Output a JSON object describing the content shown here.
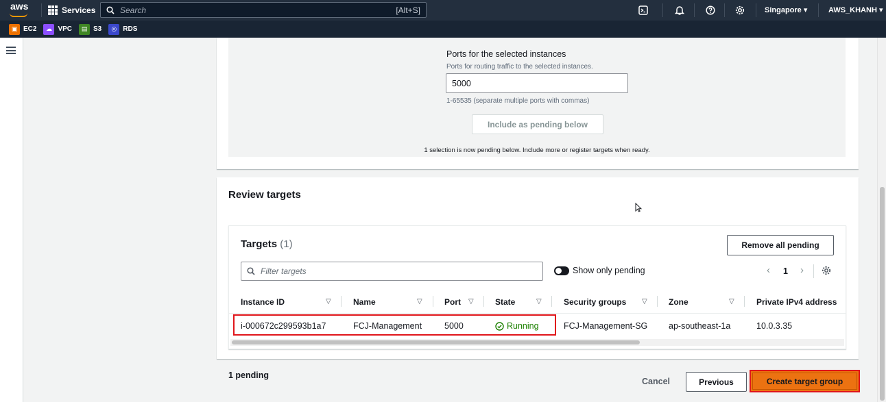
{
  "topnav": {
    "logo": "aws",
    "services_label": "Services",
    "search_placeholder": "Search",
    "search_shortcut": "[Alt+S]",
    "region": "Singapore ▾",
    "account": "AWS_KHANH ▾"
  },
  "favorites": [
    {
      "label": "EC2",
      "color": "#ed7100",
      "icon": "ec2-icon"
    },
    {
      "label": "VPC",
      "color": "#8c4fff",
      "icon": "vpc-icon"
    },
    {
      "label": "S3",
      "color": "#3f8624",
      "icon": "s3-icon"
    },
    {
      "label": "RDS",
      "color": "#3b48cc",
      "icon": "rds-icon"
    }
  ],
  "ports_section": {
    "title": "Ports for the selected instances",
    "description": "Ports for routing traffic to the selected instances.",
    "value": "5000",
    "hint": "1-65535 (separate multiple ports with commas)",
    "include_button": "Include as pending below",
    "pending_note": "1 selection is now pending below. Include more or register targets when ready."
  },
  "review": {
    "title": "Review targets",
    "targets_title": "Targets",
    "targets_count": "(1)",
    "remove_all_button": "Remove all pending",
    "filter_placeholder": "Filter targets",
    "show_only_pending": "Show only pending",
    "page_number": "1",
    "columns": [
      "Instance ID",
      "Name",
      "Port",
      "State",
      "Security groups",
      "Zone",
      "Private IPv4 address"
    ],
    "rows": [
      {
        "instance_id": "i-000672c299593b1a7",
        "name": "FCJ-Management",
        "port": "5000",
        "state": "Running",
        "security_group": "FCJ-Management-SG",
        "zone": "ap-southeast-1a",
        "ip": "10.0.3.35"
      }
    ]
  },
  "footer": {
    "pending": "1 pending",
    "cancel": "Cancel",
    "previous": "Previous",
    "create": "Create target group"
  },
  "colors": {
    "nav_bg": "#232f3e",
    "primary": "#ec7211",
    "running": "#1d8102",
    "highlight": "#e0151a"
  }
}
